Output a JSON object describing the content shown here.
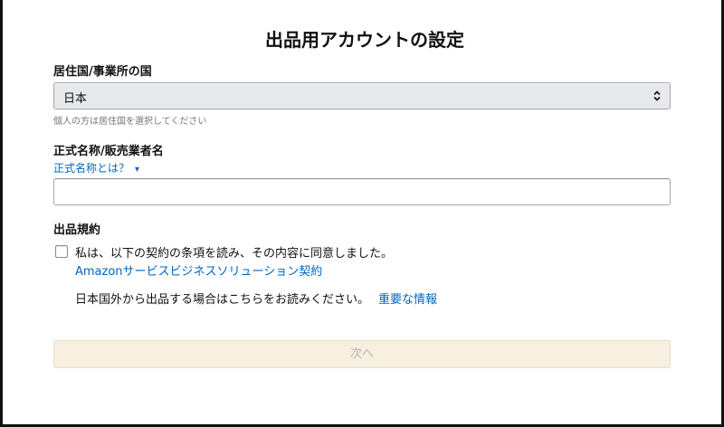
{
  "page": {
    "title": "出品用アカウントの設定"
  },
  "country": {
    "label": "居住国/事業所の国",
    "selected": "日本",
    "hint": "個人の方は居住国を選択してください"
  },
  "business_name": {
    "label": "正式名称/販売業者名",
    "help_link": "正式名称とは？",
    "value": "",
    "placeholder": ""
  },
  "terms": {
    "heading": "出品規約",
    "checkbox_checked": false,
    "agree_text": "私は、以下の契約の条項を読み、その内容に同意しました。",
    "agreement_link": "Amazonサービスビジネスソリューション契約",
    "outside_note": "日本国外から出品する場合はこちらをお読みください。",
    "important_link": "重要な情報"
  },
  "actions": {
    "next_label": "次へ"
  },
  "colors": {
    "link": "#0066c0",
    "select_bg": "#e7e9ec",
    "button_disabled_bg": "#f7efe0",
    "button_disabled_text": "#b8b0a6"
  },
  "icons": {
    "select_arrow": "up-down-chevron-icon",
    "help_caret": "caret-down-icon"
  }
}
